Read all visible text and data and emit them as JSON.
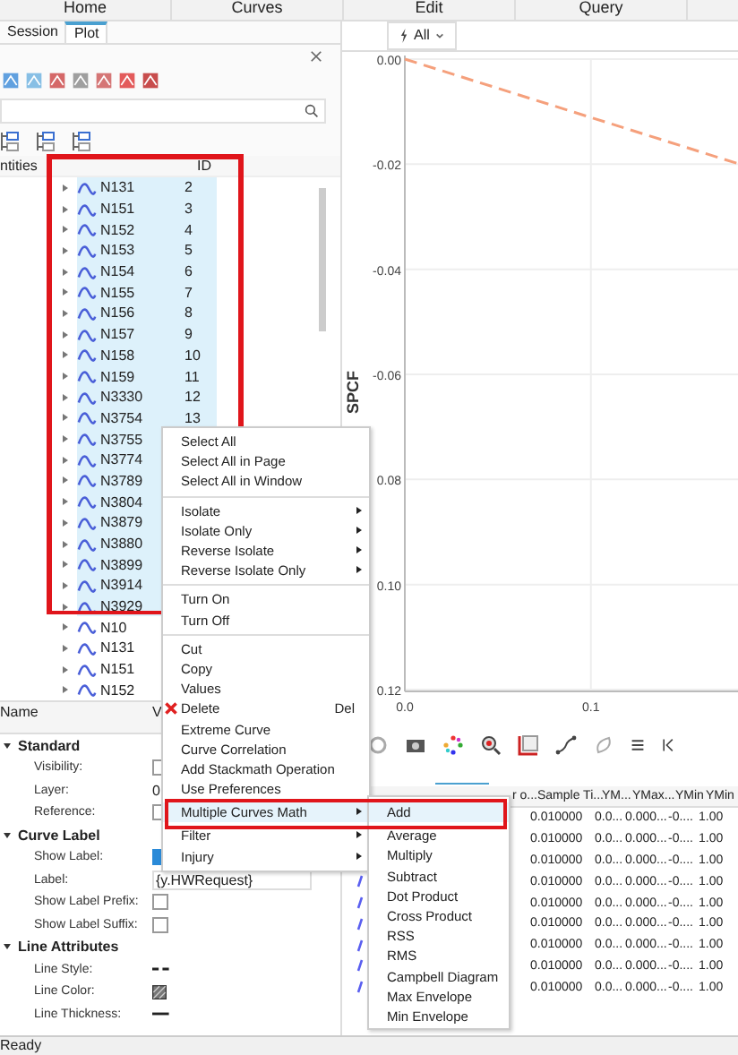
{
  "top_tabs": [
    {
      "label": "Home"
    },
    {
      "label": "Curves"
    },
    {
      "label": "Edit"
    },
    {
      "label": "Query"
    }
  ],
  "left_panel": {
    "tabs": [
      {
        "label": "Session",
        "selected": false
      },
      {
        "label": "Plot",
        "selected": true
      }
    ],
    "tree": {
      "columns": [
        "ntities",
        "ID"
      ],
      "rows": [
        {
          "name": "N131",
          "id": "2",
          "selected": true
        },
        {
          "name": "N151",
          "id": "3",
          "selected": true
        },
        {
          "name": "N152",
          "id": "4",
          "selected": true
        },
        {
          "name": "N153",
          "id": "5",
          "selected": true
        },
        {
          "name": "N154",
          "id": "6",
          "selected": true
        },
        {
          "name": "N155",
          "id": "7",
          "selected": true
        },
        {
          "name": "N156",
          "id": "8",
          "selected": true
        },
        {
          "name": "N157",
          "id": "9",
          "selected": true
        },
        {
          "name": "N158",
          "id": "10",
          "selected": true
        },
        {
          "name": "N159",
          "id": "11",
          "selected": true
        },
        {
          "name": "N3330",
          "id": "12",
          "selected": true
        },
        {
          "name": "N3754",
          "id": "13",
          "selected": true
        },
        {
          "name": "N3755",
          "selected": true
        },
        {
          "name": "N3774",
          "selected": true
        },
        {
          "name": "N3789",
          "selected": true
        },
        {
          "name": "N3804",
          "selected": true
        },
        {
          "name": "N3879",
          "selected": true
        },
        {
          "name": "N3880",
          "selected": true
        },
        {
          "name": "N3899",
          "selected": true
        },
        {
          "name": "N3914",
          "selected": true
        },
        {
          "name": "N3929",
          "selected": true
        },
        {
          "name": "N10",
          "selected": false
        },
        {
          "name": "N131",
          "selected": false
        },
        {
          "name": "N151",
          "selected": false
        },
        {
          "name": "N152",
          "selected": false
        }
      ]
    }
  },
  "properties": {
    "columns": [
      "Name",
      "V"
    ],
    "groups": [
      {
        "label": "Standard",
        "expanded": true,
        "rows": [
          {
            "label": "Visibility:",
            "kind": "checkbox",
            "checked": false
          },
          {
            "label": "Layer:",
            "kind": "text",
            "value": "0"
          },
          {
            "label": "Reference:",
            "kind": "checkbox",
            "checked": false
          }
        ]
      },
      {
        "label": "Curve Label",
        "expanded": true,
        "rows": [
          {
            "label": "Show Label:",
            "kind": "checkbox",
            "checked": true
          },
          {
            "label": "Label:",
            "kind": "field",
            "value": "{y.HWRequest}"
          },
          {
            "label": "Show Label Prefix:",
            "kind": "checkbox",
            "checked": false
          },
          {
            "label": "Show Label Suffix:",
            "kind": "checkbox",
            "checked": false
          }
        ]
      },
      {
        "label": "Line Attributes",
        "expanded": true,
        "rows": [
          {
            "label": "Line Style:",
            "kind": "line-style"
          },
          {
            "label": "Line Color:",
            "kind": "color"
          },
          {
            "label": "Line Thickness:",
            "kind": "thickness"
          }
        ]
      }
    ]
  },
  "plot": {
    "filter": "All",
    "chart_data": {
      "type": "line",
      "ylabel": "SPCF",
      "xlim": [
        0,
        0.18
      ],
      "ylim": [
        -0.12,
        0
      ],
      "xticks": [
        {
          "value": 0,
          "label": "0.0"
        },
        {
          "value": 0.1,
          "label": "0.1"
        }
      ],
      "yticks": [
        {
          "value": 0,
          "label": "0.00"
        },
        {
          "value": -0.02,
          "label": "-0.02"
        },
        {
          "value": -0.04,
          "label": "-0.04"
        },
        {
          "value": -0.06,
          "label": "-0.06"
        },
        {
          "value": -0.08,
          "label": "0.08"
        },
        {
          "value": -0.1,
          "label": "0.10"
        },
        {
          "value": -0.12,
          "label": "0.12"
        }
      ],
      "grid": true,
      "x": [
        0,
        0.18
      ],
      "series": [
        {
          "color": "#f5a07c",
          "line_style": "dashed",
          "values": [
            0,
            -0.02
          ]
        }
      ]
    }
  },
  "results_table": {
    "columns": [
      "r o...",
      "Sample Ti...",
      "YM...",
      "YMax...",
      "YMin",
      "YMin"
    ],
    "rows": [
      {
        "cells": [
          "",
          "0.010000",
          "0.0...",
          "0.000...",
          "-0....",
          "1.00"
        ]
      },
      {
        "cells": [
          "",
          "0.010000",
          "0.0...",
          "0.000...",
          "-0....",
          "1.00"
        ]
      },
      {
        "cells": [
          "",
          "0.010000",
          "0.0...",
          "0.000...",
          "-0....",
          "1.00"
        ]
      },
      {
        "cells": [
          "",
          "0.010000",
          "0.0...",
          "0.000...",
          "-0....",
          "1.00"
        ]
      },
      {
        "cells": [
          "",
          "0.010000",
          "0.0...",
          "0.000...",
          "-0....",
          "1.00"
        ]
      },
      {
        "cells": [
          "",
          "0.010000",
          "0.0...",
          "0.000...",
          "-0....",
          "1.00"
        ]
      },
      {
        "cells": [
          "",
          "0.010000",
          "0.0...",
          "0.000...",
          "-0....",
          "1.00"
        ]
      },
      {
        "cells": [
          "",
          "0.010000",
          "0.0...",
          "0.000...",
          "-0....",
          "1.00"
        ]
      },
      {
        "cells": [
          "",
          "0.010000",
          "0.0...",
          "0.000...",
          "-0....",
          "1.00"
        ]
      }
    ]
  },
  "context_menu": {
    "items": [
      {
        "kind": "item",
        "label": "Select All",
        "selected": false,
        "submenu": false
      },
      {
        "kind": "item",
        "label": "Select All in Page",
        "selected": false,
        "submenu": false
      },
      {
        "kind": "item",
        "label": "Select All in Window",
        "selected": false,
        "submenu": false
      },
      {
        "kind": "separator"
      },
      {
        "kind": "item",
        "label": "Isolate",
        "selected": false,
        "submenu": true
      },
      {
        "kind": "item",
        "label": "Isolate Only",
        "selected": false,
        "submenu": true
      },
      {
        "kind": "item",
        "label": "Reverse Isolate",
        "selected": false,
        "submenu": true
      },
      {
        "kind": "item",
        "label": "Reverse Isolate Only",
        "selected": false,
        "submenu": true
      },
      {
        "kind": "separator"
      },
      {
        "kind": "item",
        "label": "Turn On",
        "selected": false,
        "submenu": false
      },
      {
        "kind": "item",
        "label": "Turn Off",
        "selected": false,
        "submenu": false
      },
      {
        "kind": "separator"
      },
      {
        "kind": "item",
        "label": "Cut",
        "selected": false,
        "submenu": false
      },
      {
        "kind": "item",
        "label": "Copy",
        "selected": false,
        "submenu": false
      },
      {
        "kind": "item",
        "label": "Values",
        "selected": false,
        "submenu": false
      },
      {
        "kind": "delete",
        "label": "Delete",
        "shortcut": "Del",
        "selected": false,
        "submenu": false
      },
      {
        "kind": "item",
        "label": "Extreme Curve",
        "selected": false,
        "submenu": false
      },
      {
        "kind": "item",
        "label": "Curve Correlation",
        "selected": false,
        "submenu": false
      },
      {
        "kind": "item",
        "label": "Add Stackmath Operation",
        "selected": false,
        "submenu": false
      },
      {
        "kind": "item",
        "label": "Use Preferences",
        "selected": false,
        "submenu": false
      },
      {
        "kind": "item",
        "label": "Multiple Curves Math",
        "selected": true,
        "submenu": true
      },
      {
        "kind": "item",
        "label": "Filter",
        "selected": false,
        "submenu": true
      },
      {
        "kind": "item",
        "label": "Injury",
        "selected": false,
        "submenu": true
      }
    ]
  },
  "submenu": {
    "items": [
      {
        "label": "Add",
        "selected": true
      },
      {
        "label": "Average",
        "selected": false
      },
      {
        "label": "Multiply",
        "selected": false
      },
      {
        "label": "Subtract",
        "selected": false
      },
      {
        "label": "Dot Product",
        "selected": false
      },
      {
        "label": "Cross Product",
        "selected": false
      },
      {
        "label": "RSS",
        "selected": false
      },
      {
        "label": "RMS",
        "selected": false
      },
      {
        "label": "Campbell Diagram",
        "selected": false
      },
      {
        "label": "Max Envelope",
        "selected": false
      },
      {
        "label": "Min Envelope",
        "selected": false
      }
    ]
  },
  "status_bar": "Ready"
}
